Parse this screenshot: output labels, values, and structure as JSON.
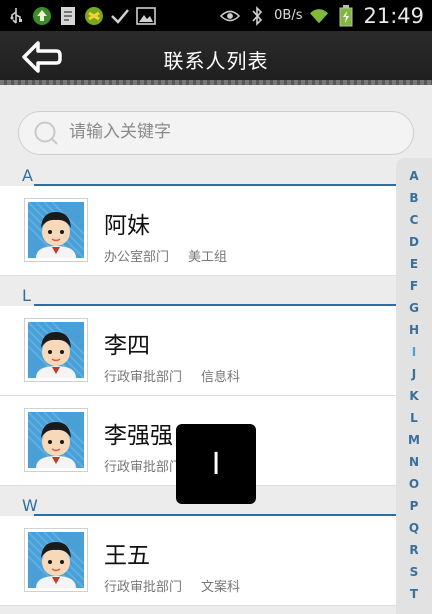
{
  "status_bar": {
    "speed": "0B/s",
    "time": "21:49",
    "left_icons": [
      "usb-icon",
      "upload-icon",
      "notes-icon",
      "app-icon",
      "check-icon",
      "image-icon"
    ],
    "right_icons": [
      "eye-icon",
      "bluetooth-icon",
      "wifi-icon",
      "battery-icon"
    ]
  },
  "header": {
    "title": "联系人列表"
  },
  "search": {
    "placeholder": "请输入关键字"
  },
  "sections": [
    {
      "letter": "A",
      "contacts": [
        {
          "name": "阿妹",
          "dept": "办公室部门",
          "group": "美工组"
        }
      ]
    },
    {
      "letter": "L",
      "contacts": [
        {
          "name": "李四",
          "dept": "行政审批部门",
          "group": "信息科"
        },
        {
          "name": "李强强",
          "dept": "行政审批部门",
          "group": ""
        }
      ]
    },
    {
      "letter": "W",
      "contacts": [
        {
          "name": "王五",
          "dept": "行政审批部门",
          "group": "文案科"
        }
      ]
    }
  ],
  "index_letters": [
    "A",
    "B",
    "C",
    "D",
    "E",
    "F",
    "G",
    "H",
    "I",
    "J",
    "K",
    "L",
    "M",
    "N",
    "O",
    "P",
    "Q",
    "R",
    "S",
    "T"
  ],
  "overlay_letter": "I",
  "colors": {
    "accent": "#2d6fa3",
    "titlebar": "#262626",
    "index_text": "#3a6f9c"
  }
}
